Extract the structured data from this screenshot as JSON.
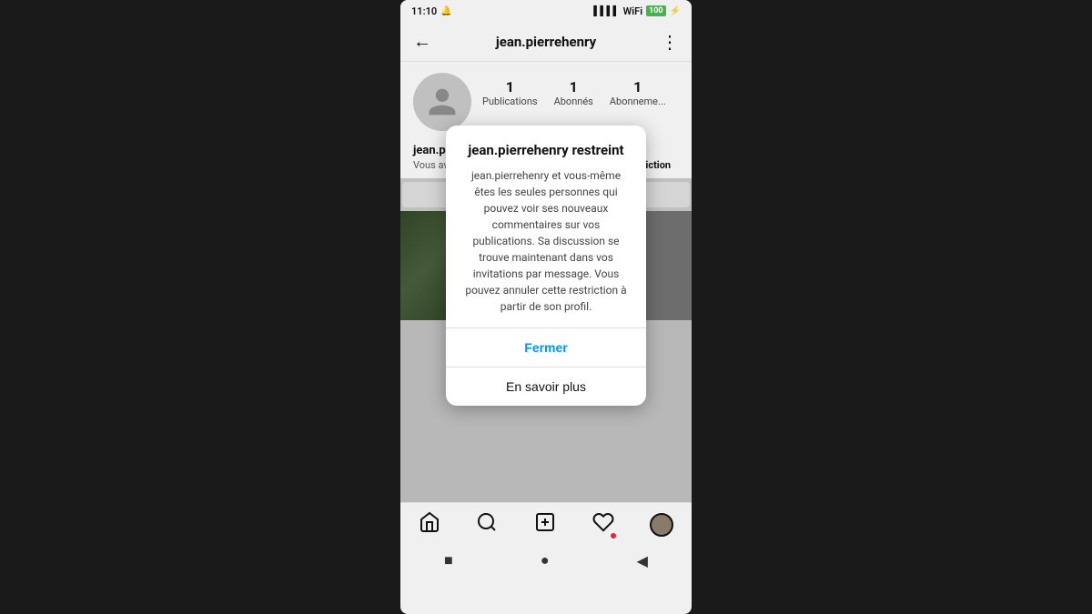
{
  "status": {
    "time": "11:10",
    "battery": "100",
    "battery_label": "100%"
  },
  "header": {
    "username": "jean.pierrehenry",
    "more_icon": "⋮",
    "back_icon": "←"
  },
  "profile": {
    "stats": [
      {
        "count": "1",
        "label": "Publications"
      },
      {
        "count": "1",
        "label": "Abonnés"
      },
      {
        "count": "1",
        "label": "Abonneme..."
      }
    ],
    "name": "jean.pierrehenry",
    "restrict_text": "Vous avez restreint jean.pierrehenry.",
    "restrict_link": "Annuler la restriction"
  },
  "modal": {
    "title": "jean.pierrehenry restreint",
    "message": "jean.pierrehenry et vous-même êtes les seules personnes qui pouvez voir ses nouveaux commentaires sur vos publications. Sa discussion se trouve maintenant dans vos invitations par message. Vous pouvez annuler cette restriction à partir de son profil.",
    "close_btn": "Fermer",
    "learn_more_btn": "En savoir plus"
  },
  "bottom_nav": {
    "home_icon": "⌂",
    "search_icon": "🔍",
    "add_icon": "⊕",
    "heart_icon": "♡",
    "avatar_icon": ""
  },
  "system_nav": {
    "stop_icon": "■",
    "home_circle": "●",
    "back_triangle": "◀"
  }
}
